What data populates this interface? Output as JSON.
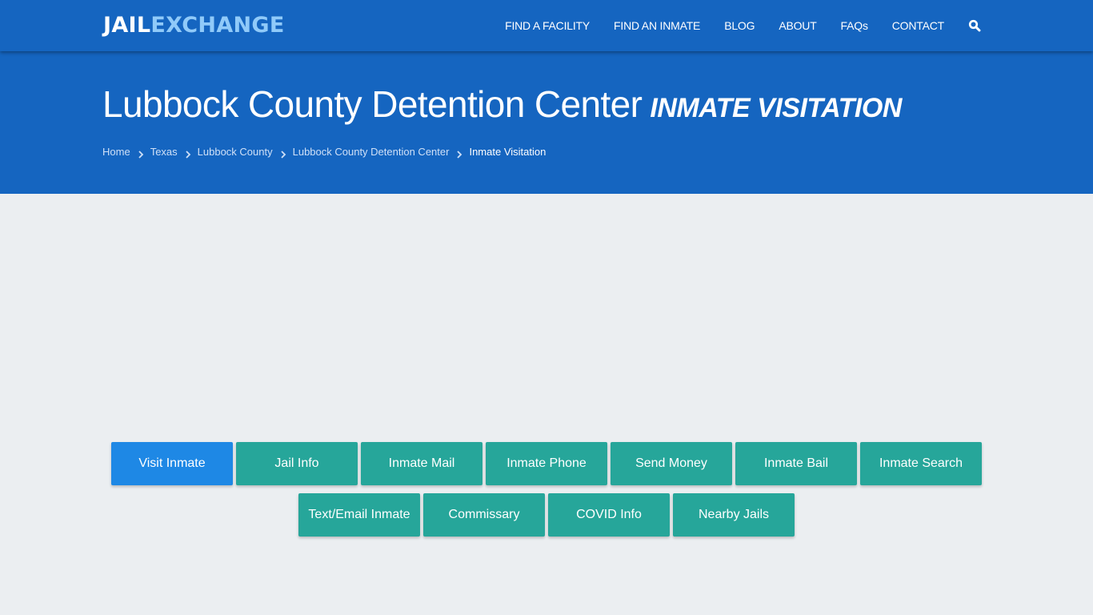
{
  "site": {
    "logo_part1": "JAIL",
    "logo_part2": "EXCHANGE",
    "brand_color": "#1565c0",
    "accent_color": "#90caf9"
  },
  "nav": {
    "items": [
      {
        "label": "FIND A FACILITY"
      },
      {
        "label": "FIND AN INMATE"
      },
      {
        "label": "BLOG"
      },
      {
        "label": "ABOUT"
      },
      {
        "label": "FAQs"
      },
      {
        "label": "CONTACT"
      }
    ],
    "search_icon": "search-icon"
  },
  "hero": {
    "title": "Lubbock County Detention Center",
    "subtitle": "INMATE VISITATION"
  },
  "breadcrumb": {
    "items": [
      {
        "label": "Home"
      },
      {
        "label": "Texas"
      },
      {
        "label": "Lubbock County"
      },
      {
        "label": "Lubbock County Detention Center"
      },
      {
        "label": "Inmate Visitation"
      }
    ],
    "separator_icon": "chevron-right-icon"
  },
  "tiles": {
    "active_color": "#1e88e5",
    "default_color": "#26a69a",
    "items": [
      {
        "label": "Visit Inmate",
        "active": true
      },
      {
        "label": "Jail Info"
      },
      {
        "label": "Inmate Mail"
      },
      {
        "label": "Inmate Phone"
      },
      {
        "label": "Send Money"
      },
      {
        "label": "Inmate Bail"
      },
      {
        "label": "Inmate Search"
      },
      {
        "label": "Text/Email Inmate"
      },
      {
        "label": "Commissary"
      },
      {
        "label": "COVID Info"
      },
      {
        "label": "Nearby Jails"
      }
    ]
  }
}
